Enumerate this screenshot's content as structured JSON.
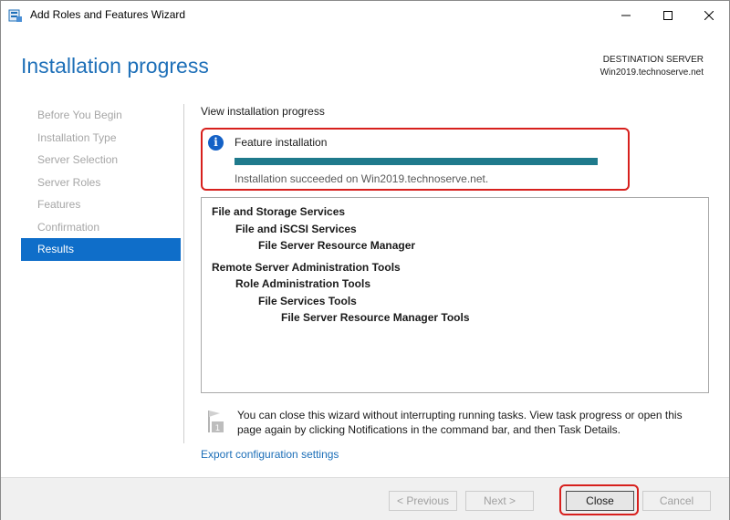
{
  "window": {
    "title": "Add Roles and Features Wizard",
    "controls": {
      "minimize": "—",
      "maximize": "☐",
      "close": "✕"
    }
  },
  "header": {
    "page_title": "Installation progress",
    "destination_label": "DESTINATION SERVER",
    "destination_server": "Win2019.technoserve.net"
  },
  "nav": {
    "items": [
      {
        "label": "Before You Begin",
        "active": false
      },
      {
        "label": "Installation Type",
        "active": false
      },
      {
        "label": "Server Selection",
        "active": false
      },
      {
        "label": "Server Roles",
        "active": false
      },
      {
        "label": "Features",
        "active": false
      },
      {
        "label": "Confirmation",
        "active": false
      },
      {
        "label": "Results",
        "active": true
      }
    ]
  },
  "main": {
    "heading": "View installation progress",
    "status": {
      "icon": "info-icon",
      "label": "Feature installation",
      "progress": 1.0,
      "message": "Installation succeeded on Win2019.technoserve.net."
    },
    "results": [
      {
        "text": "File and Storage Services",
        "level": 0
      },
      {
        "text": "File and iSCSI Services",
        "level": 1
      },
      {
        "text": "File Server Resource Manager",
        "level": 2
      },
      {
        "text": "Remote Server Administration Tools",
        "level": 0
      },
      {
        "text": "Role Administration Tools",
        "level": 1
      },
      {
        "text": "File Services Tools",
        "level": 2
      },
      {
        "text": "File Server Resource Manager Tools",
        "level": 3
      }
    ],
    "note": "You can close this wizard without interrupting running tasks. View task progress or open this page again by clicking Notifications in the command bar, and then Task Details.",
    "export_link": "Export configuration settings"
  },
  "footer": {
    "previous": "< Previous",
    "next": "Next >",
    "close": "Close",
    "cancel": "Cancel"
  },
  "colors": {
    "accent": "#1d6fb8",
    "nav_active": "#0f6ec9",
    "progress": "#1f7a8c",
    "highlight": "#d7201d"
  }
}
